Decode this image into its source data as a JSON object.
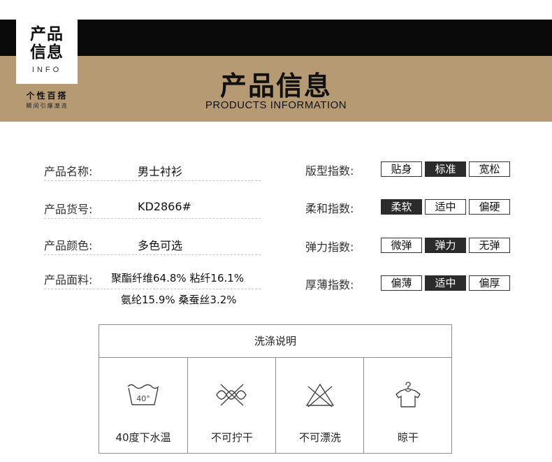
{
  "header": {
    "logo_line1": "产品",
    "logo_line2": "信息",
    "logo_info": "INFO",
    "tagline": "个性百搭",
    "tagline_sub": "瞬间引爆潮流",
    "title": "产品信息",
    "subtitle": "PRODUCTS INFORMATION"
  },
  "product": {
    "name": {
      "label": "产品名称:",
      "value": "男士衬衫"
    },
    "sku": {
      "label": "产品货号:",
      "value": "KD2866#"
    },
    "color": {
      "label": "产品颜色:",
      "value": "多色可选"
    },
    "fabric": {
      "label": "产品面料:",
      "value_line1": "聚酯纤维64.8% 粘纤16.1%",
      "value_line2": "氨纶15.9% 桑蚕丝3.2%"
    }
  },
  "indices": [
    {
      "label": "版型指数:",
      "options": [
        "贴身",
        "标准",
        "宽松"
      ],
      "selected": 1
    },
    {
      "label": "柔和指数:",
      "options": [
        "柔软",
        "适中",
        "偏硬"
      ],
      "selected": 0
    },
    {
      "label": "弹力指数:",
      "options": [
        "微弹",
        "弹力",
        "无弹"
      ],
      "selected": 1
    },
    {
      "label": "厚薄指数:",
      "options": [
        "偏薄",
        "适中",
        "偏厚"
      ],
      "selected": 1
    }
  ],
  "care": {
    "title": "洗涤说明",
    "items": [
      {
        "icon": "wash-40-icon",
        "label": "40度下水温",
        "temp": "40°"
      },
      {
        "icon": "no-wring-icon",
        "label": "不可拧干"
      },
      {
        "icon": "no-bleach-icon",
        "label": "不可漂洗"
      },
      {
        "icon": "hang-dry-icon",
        "label": "晾干"
      }
    ]
  },
  "colors": {
    "header_black": "#0a0a0a",
    "header_tan": "#b59a73",
    "selected_option": "#2b2b2b"
  }
}
